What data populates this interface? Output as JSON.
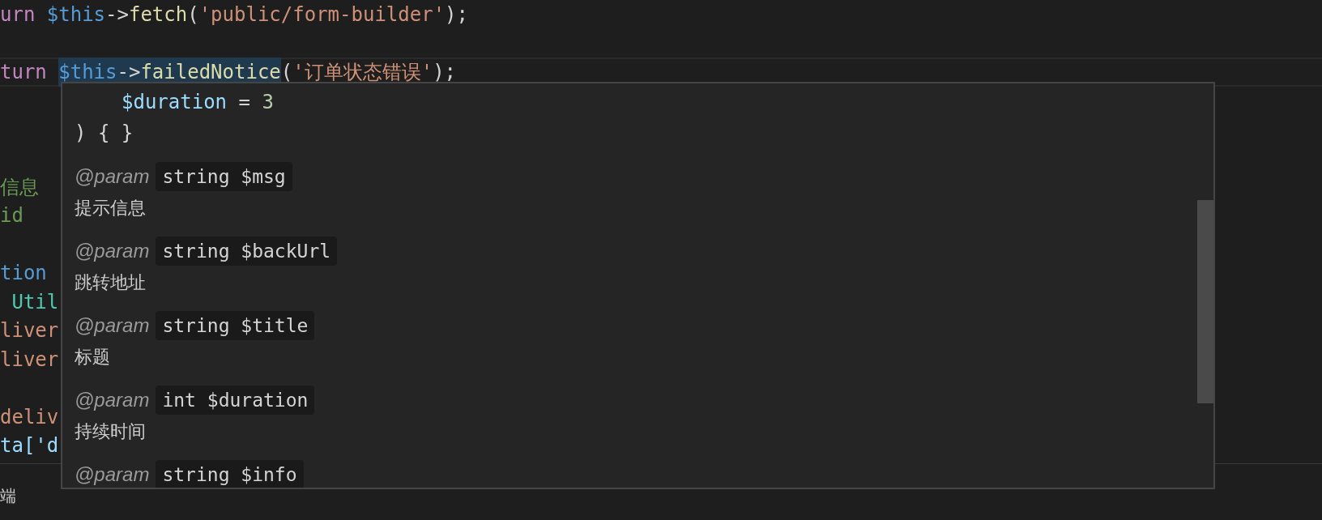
{
  "editor": {
    "lines": [
      {
        "kind": "code",
        "current": false,
        "tokens": [
          {
            "text": "urn ",
            "kind": "keyword",
            "highlighted": false
          },
          {
            "text": "$this",
            "kind": "variable",
            "highlighted": false
          },
          {
            "text": "->",
            "kind": "operator",
            "highlighted": false
          },
          {
            "text": "fetch",
            "kind": "function",
            "highlighted": false
          },
          {
            "text": "(",
            "kind": "operator",
            "highlighted": false
          },
          {
            "text": "'public/form-builder'",
            "kind": "string",
            "highlighted": false
          },
          {
            "text": ");",
            "kind": "operator",
            "highlighted": false
          }
        ]
      },
      {
        "kind": "blank"
      },
      {
        "kind": "code",
        "current": true,
        "tokens": [
          {
            "text": "turn ",
            "kind": "keyword",
            "highlighted": false
          },
          {
            "text": "$this",
            "kind": "variable",
            "highlighted": true
          },
          {
            "text": "->",
            "kind": "operator",
            "highlighted": true
          },
          {
            "text": "failedNotice",
            "kind": "function",
            "highlighted": true
          },
          {
            "text": "(",
            "kind": "operator",
            "highlighted": false
          },
          {
            "text": "'订单状态错误'",
            "kind": "string",
            "highlighted": false
          },
          {
            "text": ");",
            "kind": "operator",
            "highlighted": false
          }
        ]
      },
      {
        "kind": "blank"
      },
      {
        "kind": "blank"
      },
      {
        "kind": "blank"
      },
      {
        "kind": "code",
        "current": false,
        "tokens": [
          {
            "text": "信息",
            "kind": "comment",
            "highlighted": false
          }
        ]
      },
      {
        "kind": "code",
        "current": false,
        "tokens": [
          {
            "text": "id",
            "kind": "comment",
            "highlighted": false
          }
        ]
      },
      {
        "kind": "blank"
      },
      {
        "kind": "code",
        "current": false,
        "tokens": [
          {
            "text": "tion",
            "kind": "variable",
            "highlighted": false
          }
        ]
      },
      {
        "kind": "code",
        "current": false,
        "tokens": [
          {
            "text": " Util",
            "kind": "class",
            "highlighted": false
          }
        ]
      },
      {
        "kind": "code",
        "current": false,
        "tokens": [
          {
            "text": "liver",
            "kind": "string",
            "highlighted": false
          }
        ]
      },
      {
        "kind": "code",
        "current": false,
        "tokens": [
          {
            "text": "liver",
            "kind": "string",
            "highlighted": false
          }
        ]
      },
      {
        "kind": "blank"
      },
      {
        "kind": "code",
        "current": false,
        "tokens": [
          {
            "text": "deliv",
            "kind": "string",
            "highlighted": false
          }
        ]
      },
      {
        "kind": "code",
        "current": false,
        "tokens": [
          {
            "text": "ta['d",
            "kind": "property",
            "highlighted": false
          }
        ]
      }
    ]
  },
  "hover": {
    "signature": [
      {
        "indented": true,
        "tokens": [
          {
            "text": "$duration",
            "kind": "property"
          },
          {
            "text": " = ",
            "kind": "operator"
          },
          {
            "text": "3",
            "kind": "number"
          }
        ]
      },
      {
        "indented": false,
        "tokens": [
          {
            "text": ") { }",
            "kind": "operator"
          }
        ]
      }
    ],
    "params": [
      {
        "tag": "@param",
        "type": "string $msg",
        "description": "提示信息"
      },
      {
        "tag": "@param",
        "type": "string $backUrl",
        "description": "跳转地址"
      },
      {
        "tag": "@param",
        "type": "string $title",
        "description": "标题"
      },
      {
        "tag": "@param",
        "type": "int $duration",
        "description": "持续时间"
      },
      {
        "tag": "@param",
        "type": "string $info"
      }
    ]
  },
  "panel": {
    "label": "端"
  }
}
